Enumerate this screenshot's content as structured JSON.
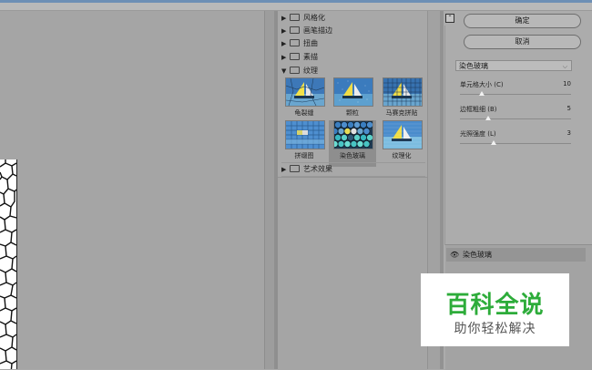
{
  "gallery": {
    "categories_top": [
      {
        "label": "风格化",
        "expanded": false
      },
      {
        "label": "画笔描边",
        "expanded": false
      },
      {
        "label": "扭曲",
        "expanded": false
      },
      {
        "label": "素描",
        "expanded": false
      },
      {
        "label": "纹理",
        "expanded": true
      }
    ],
    "texture_filters": [
      {
        "label": "龟裂缝",
        "selected": false
      },
      {
        "label": "颗粒",
        "selected": false
      },
      {
        "label": "马赛克拼贴",
        "selected": false
      },
      {
        "label": "拼缀图",
        "selected": false
      },
      {
        "label": "染色玻璃",
        "selected": true
      },
      {
        "label": "纹理化",
        "selected": false
      }
    ],
    "category_after": {
      "label": "艺术效果",
      "expanded": false
    }
  },
  "settings": {
    "collapse_icon_glyph": "⌃",
    "ok_label": "确定",
    "cancel_label": "取消",
    "filter_select_value": "染色玻璃",
    "params": [
      {
        "label": "单元格大小 (C)",
        "value": "10",
        "fraction": 0.2
      },
      {
        "label": "边框粗细 (B)",
        "value": "5",
        "fraction": 0.25
      },
      {
        "label": "光照强度 (L)",
        "value": "3",
        "fraction": 0.3
      }
    ],
    "effect_layer_name": "染色玻璃"
  },
  "watermark": {
    "title": "百科全说",
    "subtitle": "助你轻松解决"
  },
  "colors": {
    "watermark_green": "#2dac3a",
    "selection_gray": "#8e8e8e"
  }
}
